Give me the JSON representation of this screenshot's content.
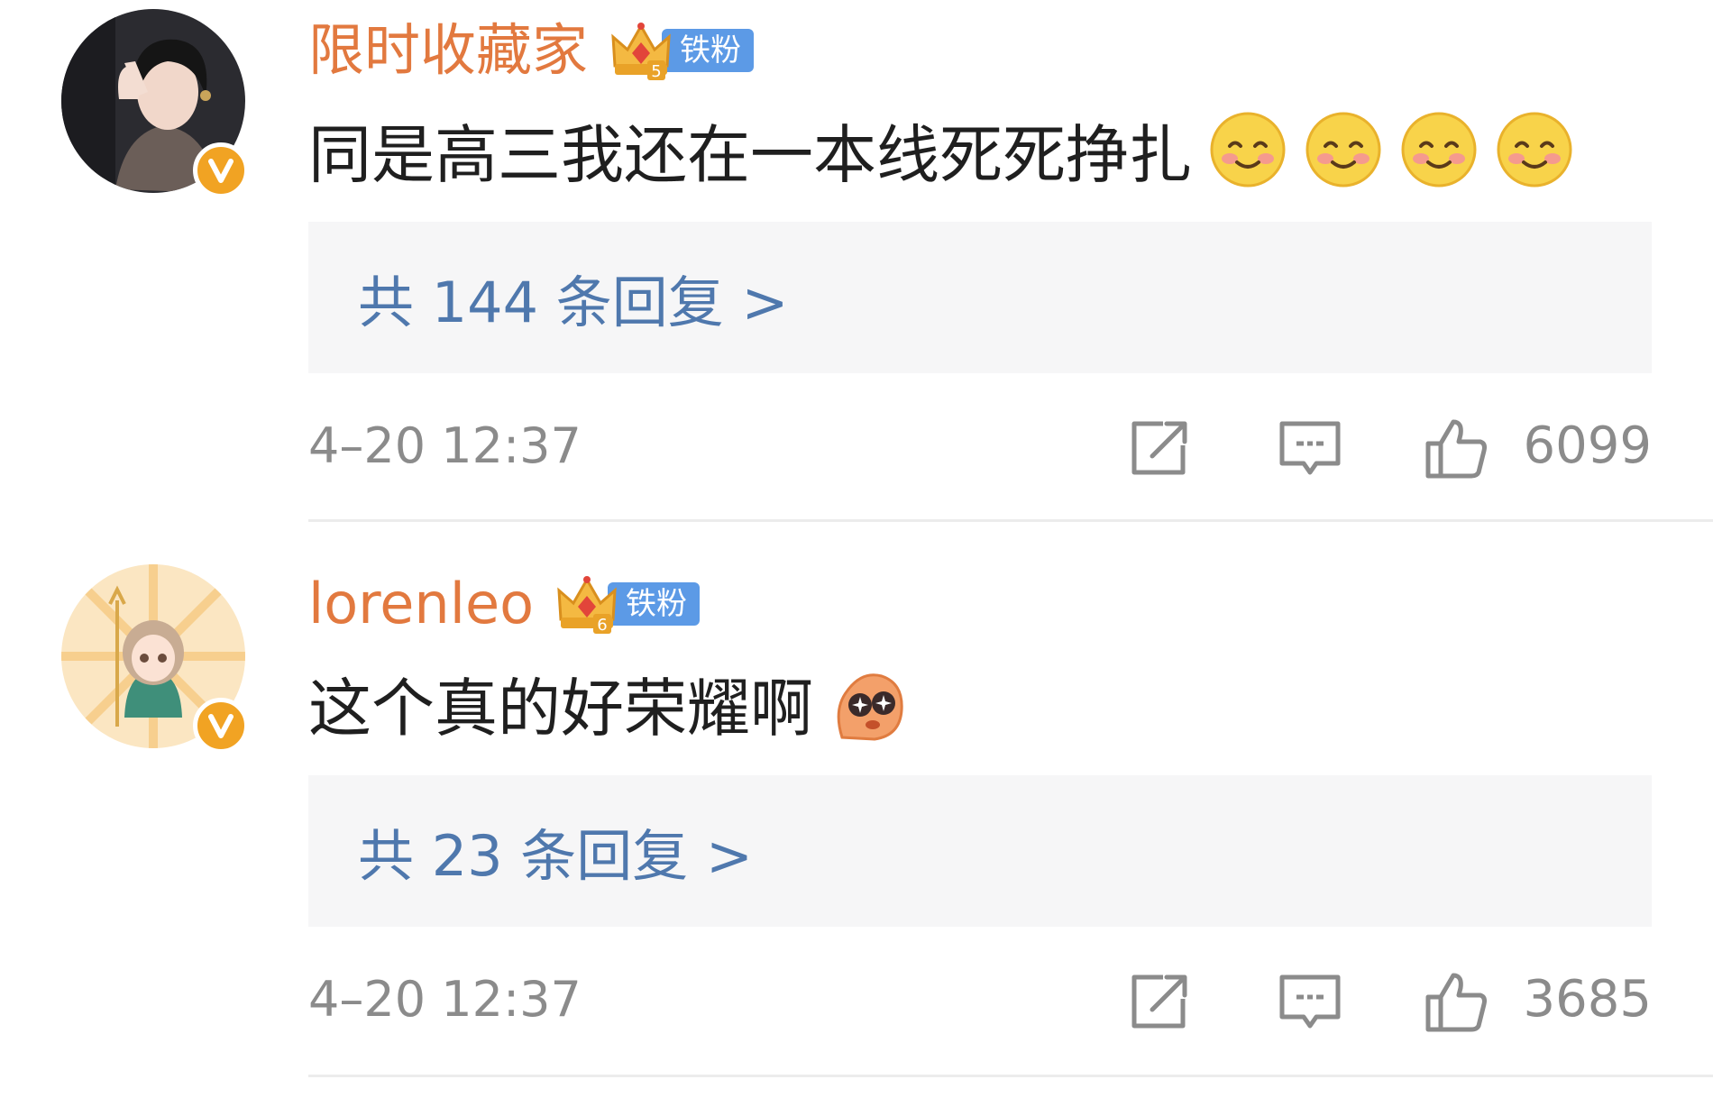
{
  "comments": [
    {
      "username": "限时收藏家",
      "fan_badge": {
        "level": "5",
        "label": "铁粉"
      },
      "text": "同是高三我还在一本线死死挣扎",
      "emojis": [
        "smile-emoji",
        "smile-emoji",
        "smile-emoji",
        "smile-emoji"
      ],
      "reply_link": "共 144 条回复 >",
      "timestamp": "4–20 12:37",
      "likes": "6099",
      "verified": true
    },
    {
      "username": "lorenleo",
      "fan_badge": {
        "level": "6",
        "label": "铁粉"
      },
      "text": "这个真的好荣耀啊",
      "emojis": [
        "starry-eyes-emoji"
      ],
      "reply_link": "共 23 条回复 >",
      "timestamp": "4–20 12:37",
      "likes": "3685",
      "verified": true
    }
  ],
  "colors": {
    "username": "#e2793f",
    "reply_link": "#4f78ad",
    "meta_text": "#8b8b8b",
    "verified_badge": "#f1a323",
    "fan_label_bg": "#5c9ae6",
    "reply_box_bg": "#f6f6f7"
  },
  "icons": {
    "share": "share-icon",
    "comment": "comment-icon",
    "like": "thumbs-up-icon",
    "verified": "verified-v-icon",
    "crown": "crown-icon"
  }
}
